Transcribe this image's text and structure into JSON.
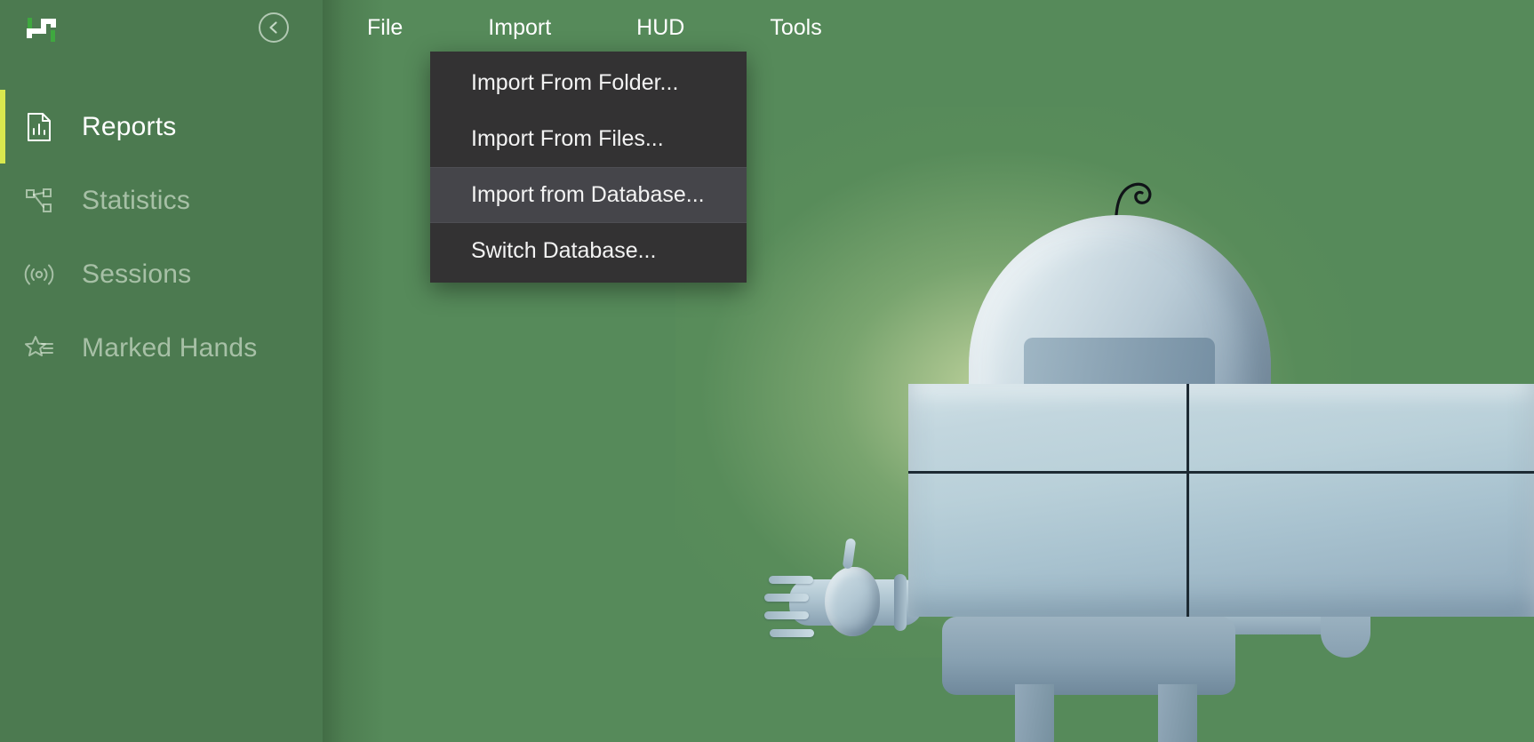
{
  "app": {
    "logo_name": "h2n-logo",
    "background_color": "#568a5a",
    "sidebar_color": "#4c7a50",
    "accent_color": "#d8e84e",
    "menu_background_color": "#333233",
    "menu_highlight_color": "#45454a"
  },
  "sidebar": {
    "collapse_button_label": "Collapse sidebar",
    "items": [
      {
        "label": "Reports",
        "icon": "report-document-icon",
        "active": true
      },
      {
        "label": "Statistics",
        "icon": "share-nodes-icon",
        "active": false
      },
      {
        "label": "Sessions",
        "icon": "broadcast-icon",
        "active": false
      },
      {
        "label": "Marked Hands",
        "icon": "star-list-icon",
        "active": false
      }
    ]
  },
  "menubar": {
    "items": [
      {
        "label": "File",
        "active": false
      },
      {
        "label": "Import",
        "active": true
      },
      {
        "label": "HUD",
        "active": false
      },
      {
        "label": "Tools",
        "active": false
      }
    ]
  },
  "import_dropdown": {
    "open": true,
    "entries": [
      {
        "label": "Import From Folder...",
        "highlighted": false
      },
      {
        "label": "Import From Files...",
        "highlighted": false
      },
      {
        "label": "Import from Database...",
        "highlighted": true
      },
      {
        "label": "Switch Database...",
        "highlighted": false
      }
    ]
  },
  "artwork": {
    "name": "friendly-robot-illustration",
    "description": "Light blue-grey cartoon robot with a curled antenna, round head, boxy torso and outstretched arms on a green background"
  }
}
